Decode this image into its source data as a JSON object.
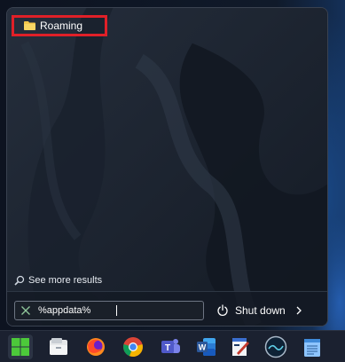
{
  "start_menu": {
    "results": [
      {
        "label": "Roaming",
        "icon": "folder-icon",
        "highlighted": true
      }
    ],
    "see_more_label": "See more results",
    "search": {
      "value": "%appdata%"
    },
    "shutdown_label": "Shut down"
  },
  "taskbar": {
    "items": [
      {
        "name": "start-button",
        "icon": "windows-logo-icon"
      },
      {
        "name": "file-explorer",
        "icon": "file-explorer-icon"
      },
      {
        "name": "firefox",
        "icon": "firefox-icon"
      },
      {
        "name": "chrome",
        "icon": "chrome-icon"
      },
      {
        "name": "teams",
        "icon": "teams-icon"
      },
      {
        "name": "word",
        "icon": "word-icon"
      },
      {
        "name": "paint-app",
        "icon": "paint-icon"
      },
      {
        "name": "monitor-app",
        "icon": "gauge-icon"
      },
      {
        "name": "notepad",
        "icon": "notepad-icon"
      }
    ]
  },
  "colors": {
    "highlight_border": "#e02028",
    "start_button_accent": "#4cc93a",
    "word_blue": "#2b579a",
    "teams_purple": "#5059c9"
  }
}
